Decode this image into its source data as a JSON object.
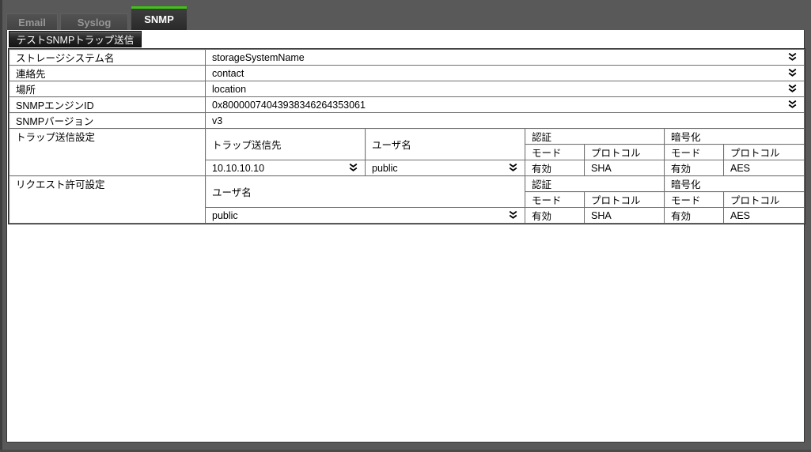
{
  "tabs": [
    {
      "label": "Email",
      "active": false
    },
    {
      "label": "Syslog",
      "active": false
    },
    {
      "label": "SNMP",
      "active": true
    }
  ],
  "toolbar": {
    "test_button_label": "テストSNMPトラップ送信"
  },
  "info_rows": [
    {
      "label": "ストレージシステム名",
      "value": "storageSystemName"
    },
    {
      "label": "連絡先",
      "value": "contact"
    },
    {
      "label": "場所",
      "value": "location"
    },
    {
      "label": "SNMPエンジンID",
      "value": "0x80000074043938346264353061"
    },
    {
      "label": "SNMPバージョン",
      "value": "v3"
    }
  ],
  "trap_section": {
    "label": "トラップ送信設定",
    "headers": {
      "destination": "トラップ送信先",
      "user": "ユーザ名",
      "auth": "認証",
      "encryption": "暗号化",
      "auth_mode": "モード",
      "auth_protocol": "プロトコル",
      "enc_mode": "モード",
      "enc_protocol": "プロトコル"
    },
    "row": {
      "destination": "10.10.10.10",
      "user": "public",
      "auth_mode": "有効",
      "auth_protocol": "SHA",
      "enc_mode": "有効",
      "enc_protocol": "AES"
    }
  },
  "request_section": {
    "label": "リクエスト許可設定",
    "headers": {
      "user": "ユーザ名",
      "auth": "認証",
      "encryption": "暗号化",
      "auth_mode": "モード",
      "auth_protocol": "プロトコル",
      "enc_mode": "モード",
      "enc_protocol": "プロトコル"
    },
    "row": {
      "user": "public",
      "auth_mode": "有効",
      "auth_protocol": "SHA",
      "enc_mode": "有効",
      "enc_protocol": "AES"
    }
  },
  "colors": {
    "active_tab_accent": "#3fc414",
    "frame_gray": "#595959",
    "header_cell_gray": "#d5d5d5"
  }
}
